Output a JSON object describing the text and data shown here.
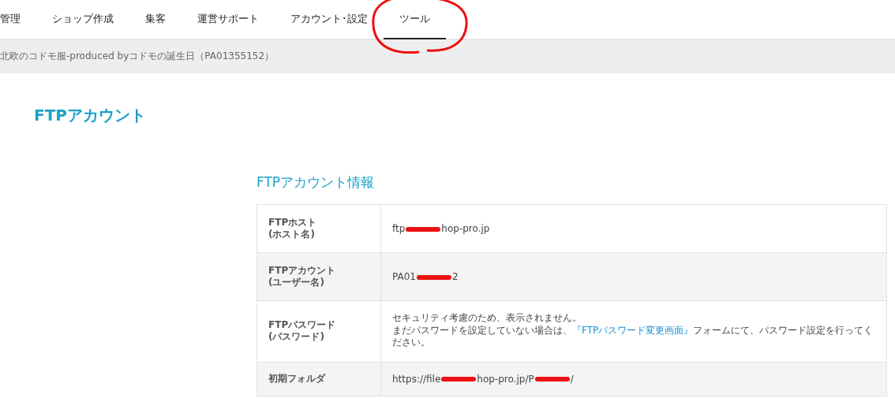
{
  "nav": {
    "tabs": [
      {
        "label": "管理",
        "selected": false
      },
      {
        "label": "ショップ作成",
        "selected": false
      },
      {
        "label": "集客",
        "selected": false
      },
      {
        "label": "運営サポート",
        "selected": false
      },
      {
        "label": "アカウント･設定",
        "selected": false
      },
      {
        "label": "ツール",
        "selected": true,
        "circled": true
      }
    ]
  },
  "shop_bar": {
    "text": "北欧のコドモ服-produced byコドモの誕生日（PA01355152）"
  },
  "page_title": "FTPアカウント",
  "section": {
    "title": "FTPアカウント情報",
    "rows": [
      {
        "kind": "redacted",
        "label": "FTPホスト\n(ホスト名)",
        "parts": [
          "ftp",
          "hop-pro.jp"
        ]
      },
      {
        "kind": "redacted",
        "label": "FTPアカウント\n(ユーザー名)",
        "parts": [
          "PA01",
          "2"
        ]
      },
      {
        "kind": "note",
        "label": "FTPパスワード\n(パスワード)",
        "lines": [
          "セキュリティ考慮のため、表示されません。"
        ],
        "before": "まだパスワードを設定していない場合は、",
        "link": "『FTPパスワード変更画面』",
        "after": "フォームにて、パスワード設定を行ってください。"
      },
      {
        "kind": "redacted",
        "label": "初期フォルダ",
        "parts": [
          "https://file",
          "hop-pro.jp/P",
          "/"
        ]
      }
    ]
  }
}
